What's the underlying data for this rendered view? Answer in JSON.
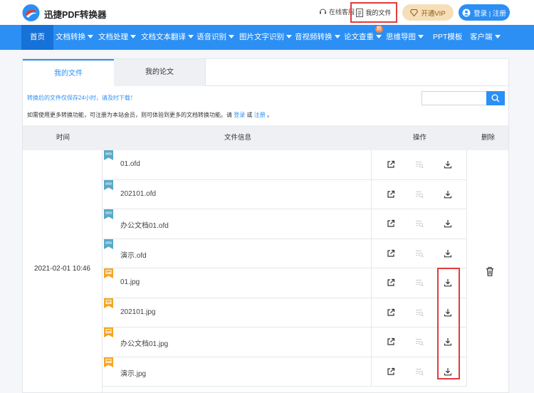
{
  "header": {
    "brand": "迅捷PDF转换器",
    "online_support": "在线客服",
    "my_files": "我的文件",
    "vip": "开通VIP",
    "login": "登录 | 注册"
  },
  "nav": {
    "items": [
      {
        "label": "首页",
        "dropdown": false,
        "active": true
      },
      {
        "label": "文档转换",
        "dropdown": true
      },
      {
        "label": "文档处理",
        "dropdown": true
      },
      {
        "label": "文档文本翻译",
        "dropdown": true
      },
      {
        "label": "语音识别",
        "dropdown": true
      },
      {
        "label": "图片文字识别",
        "dropdown": true
      },
      {
        "label": "音视频转换",
        "dropdown": true
      },
      {
        "label": "论文查重",
        "dropdown": true
      },
      {
        "label": "思维导图",
        "dropdown": true
      },
      {
        "label": "PPT模板",
        "dropdown": false
      },
      {
        "label": "客户端",
        "dropdown": true
      }
    ],
    "badge": "新"
  },
  "tabs": [
    "我的文件",
    "我的论文"
  ],
  "notice": "转换后的文件仅保存24小时，请及时下载！",
  "member": {
    "text": "如需使用更多转换功能，可注册为本站会员，则可体验到更多的文档转换功能。请",
    "login": "登录",
    "or": "或",
    "register": "注册",
    "end": "。"
  },
  "table": {
    "headers": {
      "time": "时间",
      "info": "文件信息",
      "ops": "操作",
      "delete": "删除"
    },
    "date": "2021-02-01 10:46",
    "files": [
      {
        "name": "01.ofd",
        "type": "ofd"
      },
      {
        "name": "202101.ofd",
        "type": "ofd"
      },
      {
        "name": "办公文档01.ofd",
        "type": "ofd"
      },
      {
        "name": "演示.ofd",
        "type": "ofd"
      },
      {
        "name": "01.jpg",
        "type": "jpg"
      },
      {
        "name": "202101.jpg",
        "type": "jpg"
      },
      {
        "name": "办公文档01.jpg",
        "type": "jpg"
      },
      {
        "name": "演示.jpg",
        "type": "jpg"
      }
    ]
  },
  "icons": {
    "ofd_label": "OFD",
    "ofd_color": "#5aa9c9",
    "jpg_color": "#f5a623",
    "open": "open-external-icon",
    "preview": "preview-icon",
    "download": "download-icon",
    "delete": "trash-icon"
  },
  "colors": {
    "primary": "#2b8ff4",
    "highlight": "#e23b3b",
    "vip_bg": "#f6dfb8"
  }
}
